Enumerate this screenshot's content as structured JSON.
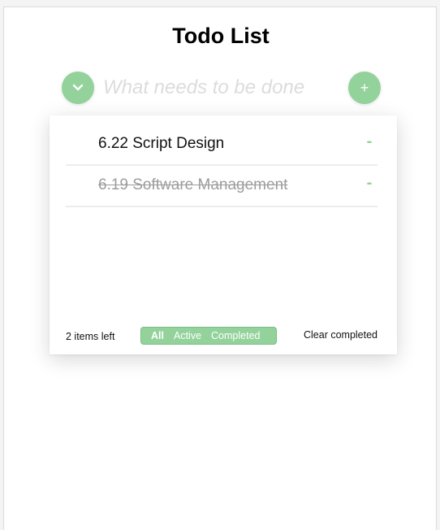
{
  "app": {
    "title": "Todo List"
  },
  "header": {
    "toggle_icon": "chevron-down-icon",
    "new_todo_placeholder": "What needs to be done",
    "new_todo_value": "",
    "add_label": "+"
  },
  "todos": [
    {
      "text": "6.22 Script Design",
      "completed": false,
      "remove_label": "-"
    },
    {
      "text": "6.19 Software Management",
      "completed": true,
      "remove_label": "-"
    }
  ],
  "footer": {
    "items_left": "2 items left",
    "filters": [
      {
        "label": "All",
        "selected": true
      },
      {
        "label": "Active",
        "selected": false
      },
      {
        "label": "Completed",
        "selected": false
      }
    ],
    "clear_completed": "Clear completed"
  },
  "colors": {
    "accent": "#93d29b",
    "completed_text": "#9c9c9c"
  }
}
